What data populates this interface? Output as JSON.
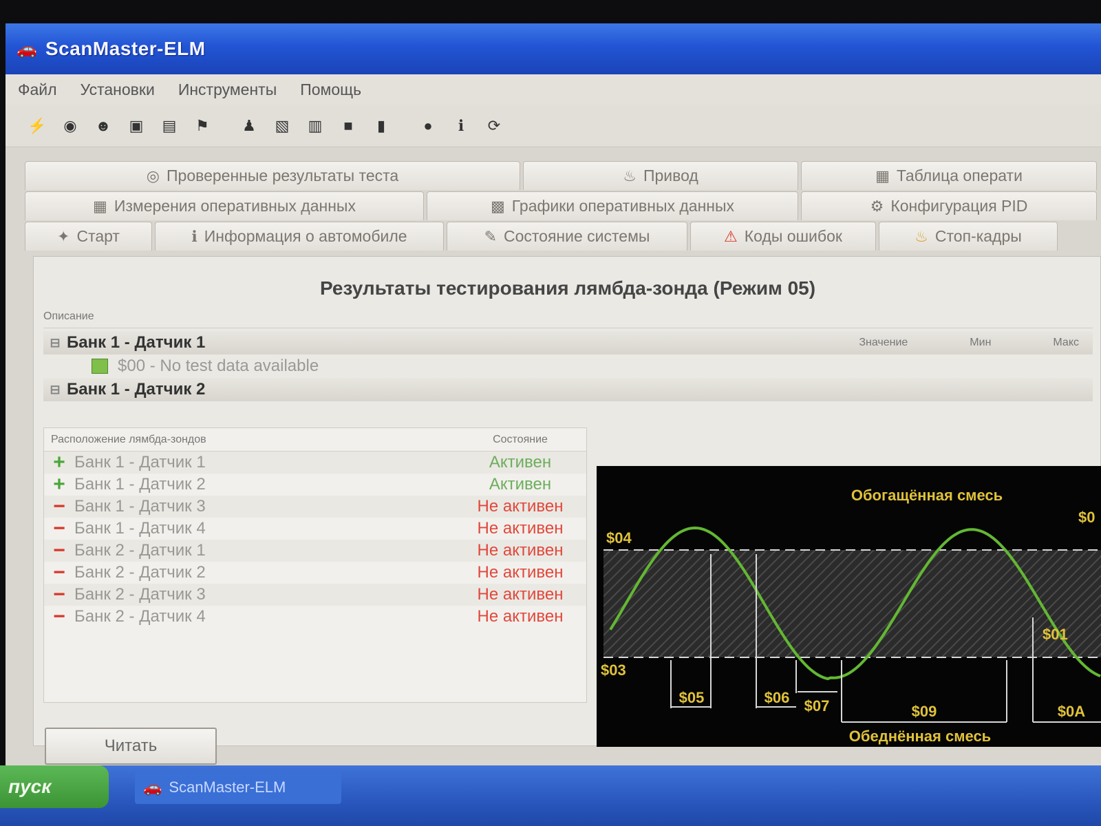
{
  "window": {
    "title": "ScanMaster-ELM",
    "app_icon": "car-icon"
  },
  "menu": [
    "Файл",
    "Установки",
    "Инструменты",
    "Помощь"
  ],
  "toolbar": [
    {
      "name": "connect-icon",
      "glyph": "⚡"
    },
    {
      "name": "globe-icon",
      "glyph": "◉"
    },
    {
      "name": "user-icon",
      "glyph": "☻"
    },
    {
      "name": "monitor-icon",
      "glyph": "▣"
    },
    {
      "name": "screen-icon",
      "glyph": "▤"
    },
    {
      "name": "flag-icon",
      "glyph": "⚑"
    },
    {
      "name": "person-icon",
      "glyph": "♟"
    },
    {
      "name": "document-icon",
      "glyph": "▧"
    },
    {
      "name": "printer-icon",
      "glyph": "▥"
    },
    {
      "name": "film-icon",
      "glyph": "■"
    },
    {
      "name": "battery-icon",
      "glyph": "▮"
    },
    {
      "name": "gauge-icon",
      "glyph": "●"
    },
    {
      "name": "help-icon",
      "glyph": "ℹ"
    },
    {
      "name": "update-icon",
      "glyph": "⟳"
    }
  ],
  "tabs": {
    "row1": [
      {
        "label": "Проверенные результаты теста",
        "icon": "check-circle-icon",
        "glyph": "◎"
      },
      {
        "label": "Привод",
        "icon": "oil-can-icon",
        "glyph": "♨"
      },
      {
        "label": "Таблица операти",
        "icon": "table-icon",
        "glyph": "▦"
      }
    ],
    "row2": [
      {
        "label": "Измерения оперативных данных",
        "icon": "chart-icon",
        "glyph": "▦"
      },
      {
        "label": "Графики оперативных данных",
        "icon": "graph-icon",
        "glyph": "▩"
      },
      {
        "label": "Конфигурация PID",
        "icon": "config-icon",
        "glyph": "⚙"
      }
    ],
    "row3": [
      {
        "label": "Старт",
        "icon": "start-icon",
        "glyph": "✦"
      },
      {
        "label": "Информация о автомобиле",
        "icon": "info-icon",
        "glyph": "ℹ"
      },
      {
        "label": "Состояние системы",
        "icon": "status-icon",
        "glyph": "✎"
      },
      {
        "label": "Коды ошибок",
        "icon": "warning-icon",
        "glyph": "⚠"
      },
      {
        "label": "Стоп-кадры",
        "icon": "freeze-icon",
        "glyph": "♨"
      }
    ]
  },
  "panel": {
    "title": "Результаты тестирования лямбда-зонда (Режим 05)",
    "tree_header": "Описание",
    "tree_cols": [
      "Значение",
      "Мин",
      "Макс"
    ],
    "groups": [
      {
        "label": "Банк 1 - Датчик 1",
        "children": [
          "$00 - No test data available"
        ]
      },
      {
        "label": "Банк 1 - Датчик 2",
        "children": []
      }
    ]
  },
  "sensors": {
    "col_location": "Расположение лямбда-зондов",
    "col_status": "Состояние",
    "rows": [
      {
        "name": "Банк 1 - Датчик 1",
        "status": "Активен",
        "active": true
      },
      {
        "name": "Банк 1 - Датчик 2",
        "status": "Активен",
        "active": true
      },
      {
        "name": "Банк 1 - Датчик 3",
        "status": "Не активен",
        "active": false
      },
      {
        "name": "Банк 1 - Датчик 4",
        "status": "Не активен",
        "active": false
      },
      {
        "name": "Банк 2 - Датчик 1",
        "status": "Не активен",
        "active": false
      },
      {
        "name": "Банк 2 - Датчик 2",
        "status": "Не активен",
        "active": false
      },
      {
        "name": "Банк 2 - Датчик 3",
        "status": "Не активен",
        "active": false
      },
      {
        "name": "Банк 2 - Датчик 4",
        "status": "Не активен",
        "active": false
      }
    ]
  },
  "diagram": {
    "top_label": "Обогащённая смесь",
    "bottom_label": "Обеднённая смесь",
    "markers": [
      "$04",
      "$03",
      "$05",
      "$06",
      "$07",
      "$09",
      "$01",
      "$0A",
      "$0"
    ]
  },
  "read_button": "Читать",
  "taskbar": {
    "start_label": "пуск",
    "task_label": "ScanMaster-ELM",
    "task_icon": "car-icon"
  }
}
